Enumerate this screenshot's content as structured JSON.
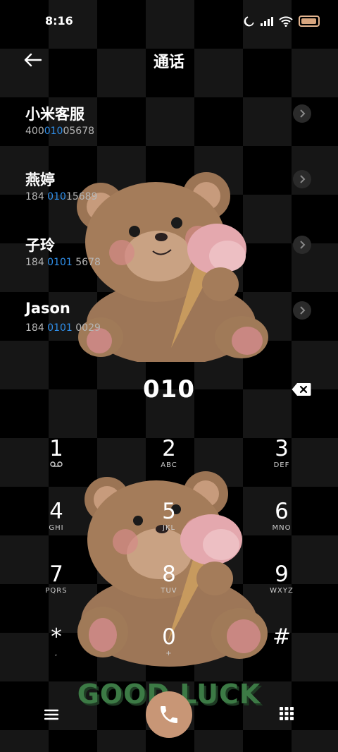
{
  "status_bar": {
    "time": "8:16",
    "icons": [
      "moon-icon",
      "signal-icon",
      "wifi-icon",
      "battery-icon"
    ],
    "battery_percent": 80
  },
  "header": {
    "back_icon": "arrow-left-icon",
    "title": "通话"
  },
  "contacts": [
    {
      "name": "小米客服",
      "number_parts": [
        {
          "text": "400",
          "hl": false
        },
        {
          "text": "010",
          "hl": true
        },
        {
          "text": "05678",
          "hl": false
        }
      ]
    },
    {
      "name": "燕婷",
      "number_parts": [
        {
          "text": "184 ",
          "hl": false
        },
        {
          "text": "010",
          "hl": true
        },
        {
          "text": "15689",
          "hl": false
        }
      ]
    },
    {
      "name": "子玲",
      "number_parts": [
        {
          "text": "184 ",
          "hl": false
        },
        {
          "text": "0101",
          "hl": true
        },
        {
          "text": " 5678",
          "hl": false
        }
      ]
    },
    {
      "name": "Jason",
      "number_parts": [
        {
          "text": "184 ",
          "hl": false
        },
        {
          "text": "0101",
          "hl": true
        },
        {
          "text": " 0029",
          "hl": false
        }
      ]
    }
  ],
  "dialer": {
    "entered": "010",
    "delete_icon": "backspace-icon"
  },
  "keypad": [
    {
      "digit": "1",
      "letters": "",
      "sub_icon": "voicemail-icon"
    },
    {
      "digit": "2",
      "letters": "ABC"
    },
    {
      "digit": "3",
      "letters": "DEF"
    },
    {
      "digit": "4",
      "letters": "GHI"
    },
    {
      "digit": "5",
      "letters": "JKL"
    },
    {
      "digit": "6",
      "letters": "MNO"
    },
    {
      "digit": "7",
      "letters": "PQRS"
    },
    {
      "digit": "8",
      "letters": "TUV"
    },
    {
      "digit": "9",
      "letters": "WXYZ"
    },
    {
      "digit": "*",
      "letters": ","
    },
    {
      "digit": "0",
      "letters": "+"
    },
    {
      "digit": "#",
      "letters": ""
    }
  ],
  "wallpaper_text": "GOOD LUCK",
  "bottom_bar": {
    "menu_icon": "menu-icon",
    "call_icon": "phone-icon",
    "keypad_icon": "dialpad-icon"
  },
  "colors": {
    "highlight": "#2f8ee8",
    "call_button": "#c89676",
    "battery": "#d7a57e"
  }
}
